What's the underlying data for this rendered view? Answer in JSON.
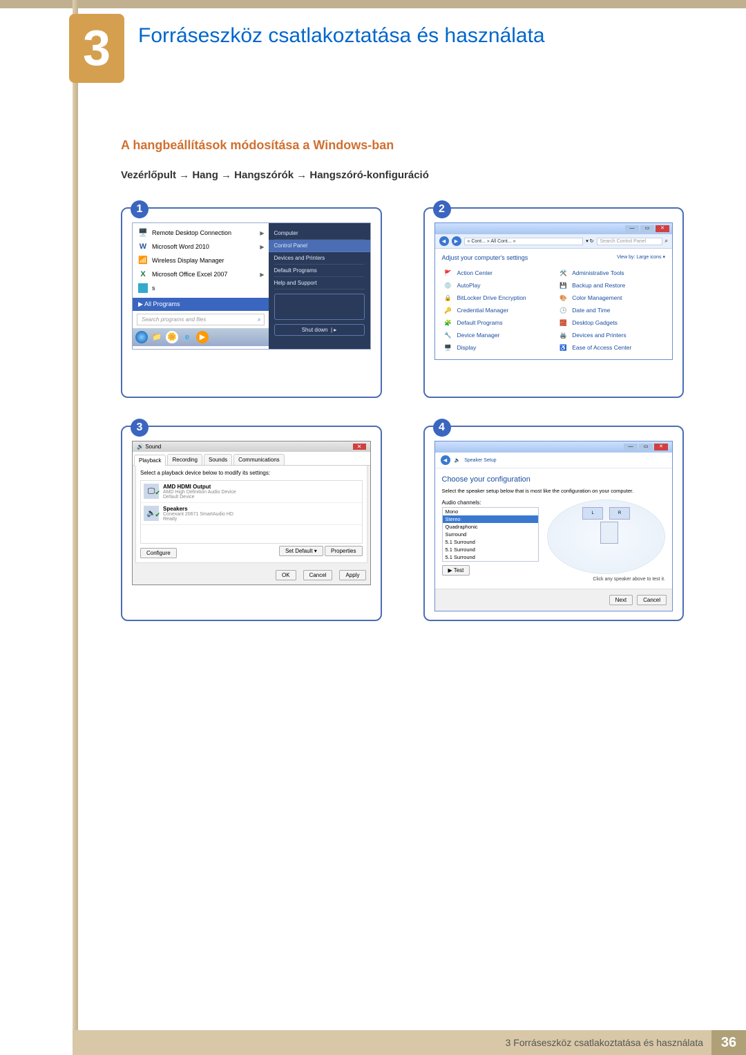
{
  "chapter": {
    "number": "3",
    "title": "Forráseszköz csatlakoztatása és használata"
  },
  "section_title": "A hangbeállítások módosítása a Windows-ban",
  "breadcrumb": "Vezérlőpult  →  Hang  →  Hangszórók  →  Hangszóró-konfiguráció",
  "steps": {
    "s1": "1",
    "s2": "2",
    "s3": "3",
    "s4": "4"
  },
  "panel1": {
    "start_menu": {
      "items": [
        {
          "label": "Remote Desktop Connection",
          "sub": true
        },
        {
          "label": "Microsoft Word 2010",
          "sub": true
        },
        {
          "label": "Wireless Display Manager"
        },
        {
          "label": "Microsoft Office Excel 2007",
          "sub": true
        },
        {
          "label": "s"
        }
      ],
      "all_programs": "All Programs",
      "search_placeholder": "Search programs and files",
      "right": {
        "computer": "Computer",
        "control_panel": "Control Panel",
        "devices": "Devices and Printers",
        "default_programs": "Default Programs",
        "help": "Help and Support",
        "shutdown": "Shut down"
      }
    }
  },
  "panel2": {
    "crumb": "« Cont... » All Cont... »",
    "search_placeholder": "Search Control Panel",
    "heading": "Adjust your computer's settings",
    "view": "View by:  Large icons ▾",
    "items_left": [
      "Action Center",
      "AutoPlay",
      "BitLocker Drive Encryption",
      "Credential Manager",
      "Default Programs",
      "Device Manager",
      "Display"
    ],
    "items_right": [
      "Administrative Tools",
      "Backup and Restore",
      "Color Management",
      "Date and Time",
      "Desktop Gadgets",
      "Devices and Printers",
      "Ease of Access Center"
    ]
  },
  "panel3": {
    "title": "Sound",
    "tabs": [
      "Playback",
      "Recording",
      "Sounds",
      "Communications"
    ],
    "hint": "Select a playback device below to modify its settings:",
    "devices": [
      {
        "name": "AMD HDMI Output",
        "sub1": "AMD High Definition Audio Device",
        "sub2": "Default Device"
      },
      {
        "name": "Speakers",
        "sub1": "Conexant 20671 SmartAudio HD",
        "sub2": "Ready"
      }
    ],
    "buttons": {
      "configure": "Configure",
      "set_default": "Set Default ▾",
      "properties": "Properties",
      "ok": "OK",
      "cancel": "Cancel",
      "apply": "Apply"
    }
  },
  "panel4": {
    "winhead": "Speaker Setup",
    "title": "Choose your configuration",
    "hint": "Select the speaker setup below that is most like the configuration on your computer.",
    "channels_label": "Audio channels:",
    "options": [
      "Mono",
      "Stereo",
      "Quadraphonic",
      "Surround",
      "5.1 Surround",
      "5.1 Surround",
      "5.1 Surround"
    ],
    "selected": "Stereo",
    "test": "▶ Test",
    "click_hint": "Click any speaker above to test it.",
    "next": "Next",
    "cancel": "Cancel"
  },
  "footer": {
    "text": "3 Forráseszköz csatlakoztatása és használata",
    "page": "36"
  }
}
